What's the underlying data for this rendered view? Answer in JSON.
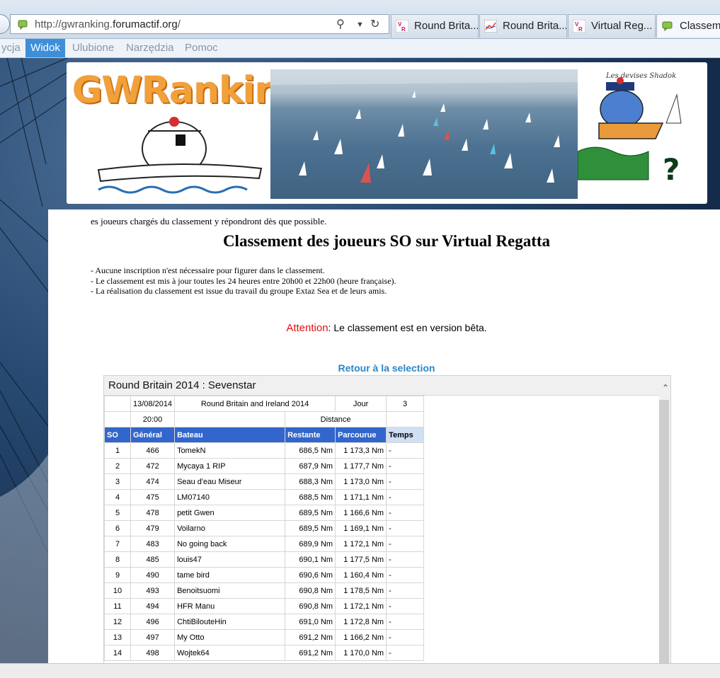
{
  "browser": {
    "url_prefix": "http://gwranking.",
    "url_domain": "forumactif.org",
    "url_suffix": "/",
    "tabs": [
      {
        "label": "Round Brita..."
      },
      {
        "label": "Round Brita..."
      },
      {
        "label": "Virtual Reg..."
      },
      {
        "label": "Classem..."
      }
    ],
    "menu": [
      "ycja",
      "Widok",
      "Ulubione",
      "Narzędzia",
      "Pomoc"
    ]
  },
  "banner": {
    "logo": "GWRanking",
    "cartoon_caption": "Les devises Shadok"
  },
  "page": {
    "intro_line": "es joueurs chargés du classement y répondront dès que possible.",
    "title": "Classement des joueurs SO sur Virtual Regatta",
    "notes": [
      "- Aucune inscription n'est nécessaire pour figurer dans le classement.",
      "- Le classement est mis à jour toutes les 24 heures entre 20h00 et 22h00 (heure française).",
      "- La réalisation du classement est issue du travail du groupe Extaz Sea et de leurs amis."
    ],
    "attention_label": "Attention",
    "attention_text": ": Le classement est en version bêta.",
    "back_link": "Retour à la selection"
  },
  "panel": {
    "title": "Round Britain 2014 : Sevenstar",
    "info": {
      "date": "13/08/2014",
      "race": "Round Britain and Ireland 2014",
      "day_label": "Jour",
      "day_value": "3",
      "time": "20:00",
      "distance_label": "Distance"
    },
    "headers": [
      "SO",
      "Général",
      "Bateau",
      "Restante",
      "Parcourue",
      "Temps"
    ],
    "rows": [
      {
        "so": "1",
        "general": "466",
        "bateau": "TomekN",
        "restante": "686,5 Nm",
        "parcourue": "1 173,3 Nm",
        "temps": "-"
      },
      {
        "so": "2",
        "general": "472",
        "bateau": "Mycaya 1 RIP",
        "restante": "687,9 Nm",
        "parcourue": "1 177,7 Nm",
        "temps": "-"
      },
      {
        "so": "3",
        "general": "474",
        "bateau": "Seau d'eau Miseur",
        "restante": "688,3 Nm",
        "parcourue": "1 173,0 Nm",
        "temps": "-"
      },
      {
        "so": "4",
        "general": "475",
        "bateau": "LM07140",
        "restante": "688,5 Nm",
        "parcourue": "1 171,1 Nm",
        "temps": "-"
      },
      {
        "so": "5",
        "general": "478",
        "bateau": "petit Gwen",
        "restante": "689,5 Nm",
        "parcourue": "1 166,6 Nm",
        "temps": "-"
      },
      {
        "so": "6",
        "general": "479",
        "bateau": "Voilarno",
        "restante": "689,5 Nm",
        "parcourue": "1 169,1 Nm",
        "temps": "-"
      },
      {
        "so": "7",
        "general": "483",
        "bateau": "No going back",
        "restante": "689,9 Nm",
        "parcourue": "1 172,1 Nm",
        "temps": "-"
      },
      {
        "so": "8",
        "general": "485",
        "bateau": "louis47",
        "restante": "690,1 Nm",
        "parcourue": "1 177,5 Nm",
        "temps": "-"
      },
      {
        "so": "9",
        "general": "490",
        "bateau": "tame bird",
        "restante": "690,6 Nm",
        "parcourue": "1 160,4 Nm",
        "temps": "-"
      },
      {
        "so": "10",
        "general": "493",
        "bateau": "Benoitsuomi",
        "restante": "690,8 Nm",
        "parcourue": "1 178,5 Nm",
        "temps": "-"
      },
      {
        "so": "11",
        "general": "494",
        "bateau": "HFR Manu",
        "restante": "690,8 Nm",
        "parcourue": "1 172,1 Nm",
        "temps": "-"
      },
      {
        "so": "12",
        "general": "496",
        "bateau": "ChtiBilouteHin",
        "restante": "691,0 Nm",
        "parcourue": "1 172,8 Nm",
        "temps": "-"
      },
      {
        "so": "13",
        "general": "497",
        "bateau": "My Otto",
        "restante": "691,2 Nm",
        "parcourue": "1 166,2 Nm",
        "temps": "-"
      },
      {
        "so": "14",
        "general": "498",
        "bateau": "Wojtek64",
        "restante": "691,2 Nm",
        "parcourue": "1 170,0 Nm",
        "temps": "-"
      }
    ]
  },
  "colors": {
    "accent": "#3366cc",
    "attention": "#e01010",
    "link": "#2b86c5",
    "logo": "#f2a03a"
  }
}
